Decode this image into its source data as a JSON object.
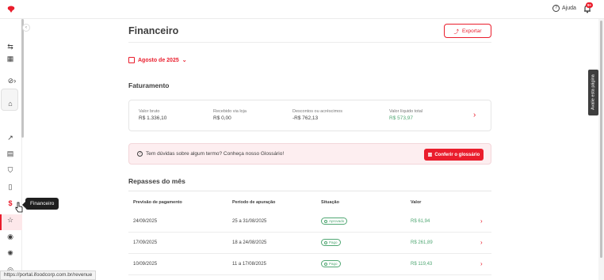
{
  "topbar": {
    "help_label": "Ajuda",
    "notification_count": "9+"
  },
  "sidebar": {
    "tooltip": "Financeiro",
    "items": [
      {
        "icon": "transfer-icon"
      },
      {
        "icon": "store-icon"
      },
      {
        "icon": "status-icon"
      },
      {
        "icon": "home-icon"
      },
      {
        "icon": "chart-icon"
      },
      {
        "icon": "orders-icon"
      },
      {
        "icon": "shield-icon"
      },
      {
        "icon": "menu-icon"
      },
      {
        "icon": "dollar-icon",
        "active": true
      },
      {
        "icon": "star-icon"
      },
      {
        "icon": "target-icon"
      },
      {
        "icon": "bulb-icon"
      }
    ]
  },
  "header": {
    "title": "Financeiro",
    "export_label": "Exportar",
    "date_selector": "Agosto de 2025"
  },
  "billing": {
    "title": "Faturamento",
    "kpis": [
      {
        "label": "Valor bruto",
        "value": "R$ 1.336,10"
      },
      {
        "label": "Recebido via loja",
        "value": "R$ 0,00"
      },
      {
        "label": "Descontos ou acréscimos",
        "value": "-R$ 762,13"
      },
      {
        "label": "Valor líquido total",
        "value": "R$ 573,97"
      }
    ]
  },
  "glossary": {
    "text": "Tem dúvidas sobre algum termo? Conheça nosso Glossário!",
    "button": "Conferir o glossário"
  },
  "repasses": {
    "title": "Repasses do mês",
    "columns": [
      "Previsão de pagamento",
      "Período de apuração",
      "Situação",
      "Valor"
    ],
    "rows": [
      {
        "date": "24/09/2025",
        "period": "25 a 31/08/2025",
        "status": "Aprovado",
        "value": "R$ 61,94"
      },
      {
        "date": "17/09/2025",
        "period": "18 a 24/08/2025",
        "status": "Pago",
        "value": "R$ 261,89"
      },
      {
        "date": "10/09/2025",
        "period": "11 a 17/08/2025",
        "status": "Pago",
        "value": "R$ 119,43"
      }
    ]
  },
  "feedback_tab": "Avalie esta página",
  "status_url": "https://portal.ifoodcorp.com.br/revenue",
  "colors": {
    "accent": "#ea1d2c",
    "positive": "#50a773"
  }
}
